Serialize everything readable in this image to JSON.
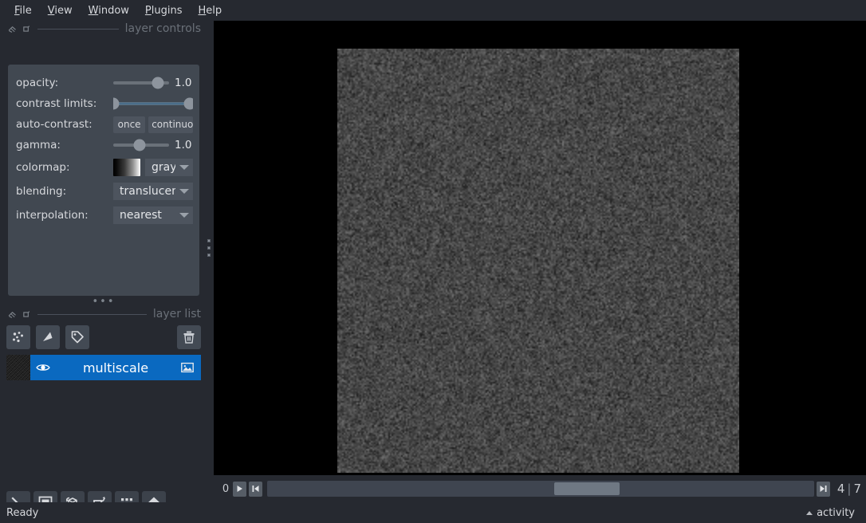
{
  "menubar": {
    "items": [
      {
        "accel": "F",
        "rest": "ile"
      },
      {
        "accel": "V",
        "rest": "iew"
      },
      {
        "accel": "W",
        "rest": "indow"
      },
      {
        "accel": "P",
        "rest": "lugins"
      },
      {
        "accel": "H",
        "rest": "elp"
      }
    ]
  },
  "layer_controls": {
    "dock_title": "layer controls",
    "rows": {
      "opacity": {
        "label": "opacity:",
        "value": "1.0",
        "slider_percent": 80
      },
      "contrast_limits": {
        "label": "contrast limits:",
        "low_percent": 0,
        "high_percent": 100
      },
      "auto_contrast": {
        "label": "auto-contrast:",
        "once_label": "once",
        "continuous_label": "continuous"
      },
      "gamma": {
        "label": "gamma:",
        "value": "1.0",
        "slider_percent": 47
      },
      "colormap": {
        "label": "colormap:",
        "value": "gray"
      },
      "blending": {
        "label": "blending:",
        "value": "translucent"
      },
      "interpolation": {
        "label": "interpolation:",
        "value": "nearest"
      }
    }
  },
  "layer_list": {
    "dock_title": "layer list",
    "buttons": [
      {
        "name": "new-points-layer",
        "icon": "points-icon"
      },
      {
        "name": "new-shapes-layer",
        "icon": "shapes-icon"
      },
      {
        "name": "new-labels-layer",
        "icon": "labels-icon"
      }
    ],
    "delete_button": {
      "name": "delete-layer",
      "icon": "trash-icon"
    },
    "layers": [
      {
        "name": "multiscale",
        "visible": true,
        "selected": true,
        "type_icon": "image-layer-icon"
      }
    ]
  },
  "viewer_buttons": [
    {
      "name": "console-button",
      "icon": "console-icon"
    },
    {
      "name": "ndisplay-button",
      "icon": "square-2d-icon"
    },
    {
      "name": "roll-dims-button",
      "icon": "cube-roll-icon"
    },
    {
      "name": "transpose-dims-button",
      "icon": "transpose-icon"
    },
    {
      "name": "grid-view-button",
      "icon": "grid-icon"
    },
    {
      "name": "reset-view-button",
      "icon": "home-icon"
    }
  ],
  "dims": {
    "axis_label": "0",
    "play_label": "play",
    "current_step": "4",
    "separator": "|",
    "total_steps": "7",
    "slider_handle_percent": 52.5
  },
  "statusbar": {
    "status": "Ready",
    "activity_label": "activity"
  },
  "colors": {
    "window_background": "#262930",
    "panel_background": "#414851",
    "control_background": "#4d545e",
    "selection_blue": "#0a69c0",
    "canvas_background": "#000000",
    "text": "#d6d8dc",
    "dock_title_text": "#6a7078"
  }
}
